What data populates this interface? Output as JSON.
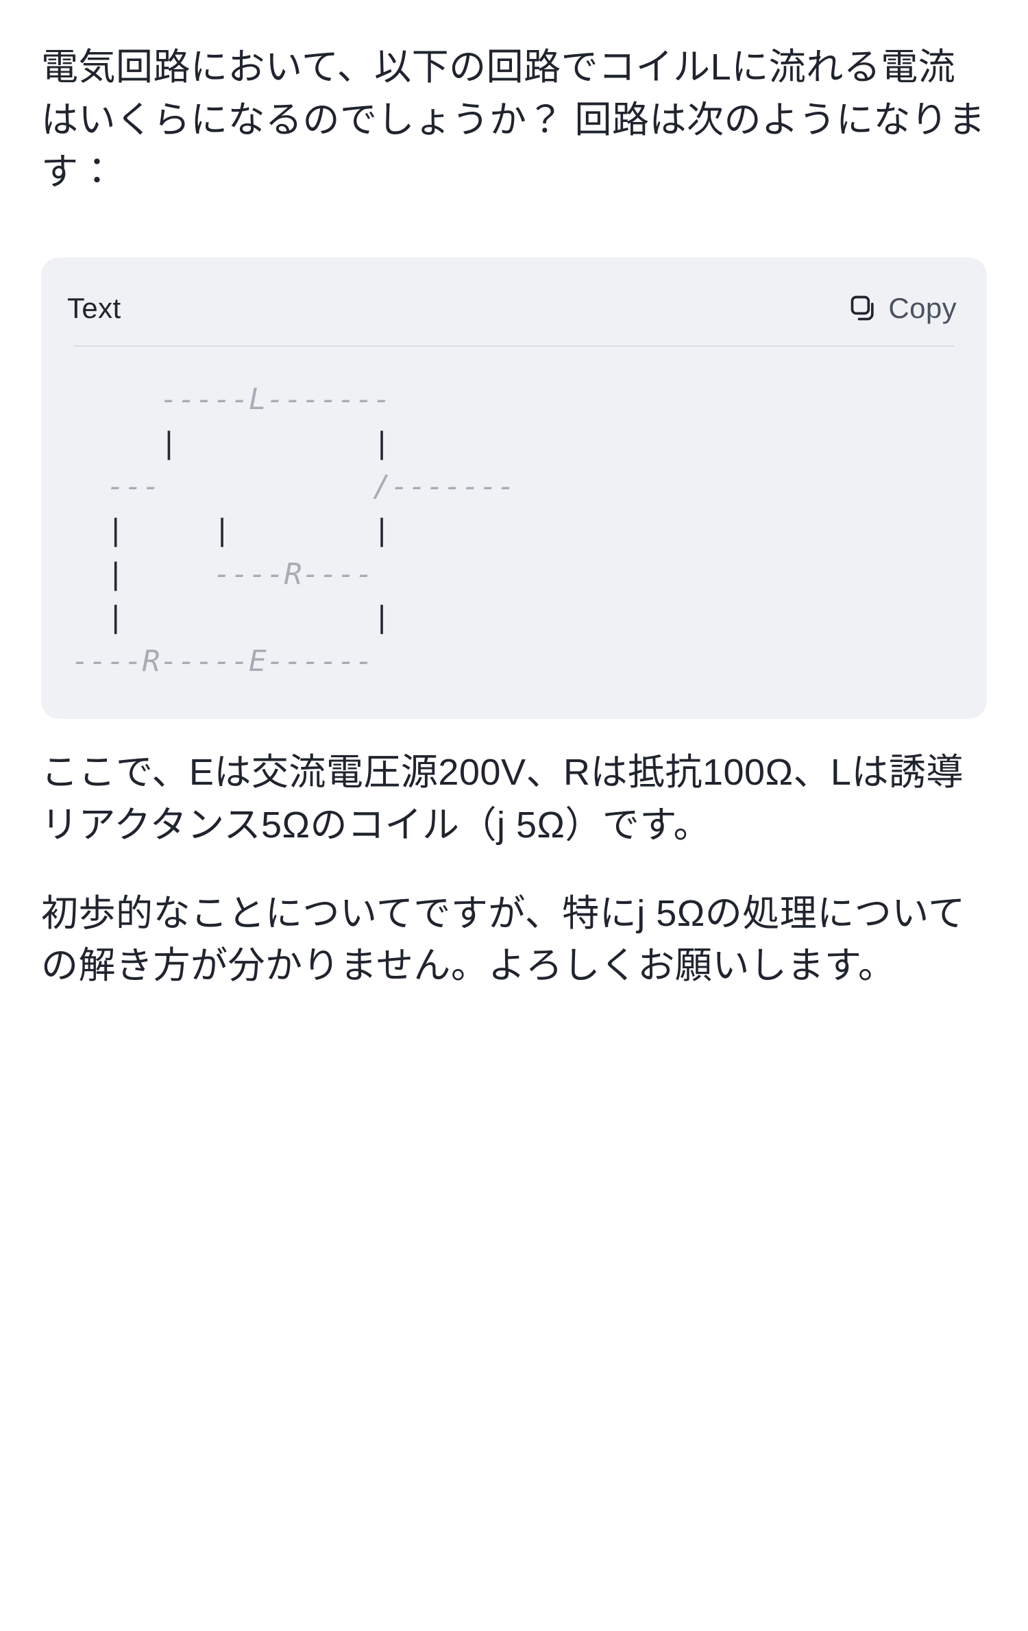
{
  "document": {
    "background_color": "#ffffff",
    "text_color": "#20242e"
  },
  "paragraphs": {
    "intro": "電気回路において、以下の回路でコイルLに流れる電流はいくらになるのでしょうか？ 回路は次のようになります：",
    "legend": "ここで、Eは交流電圧源200V、Rは抵抗100Ω、Lは誘導リアクタンス5Ωのコイル（j 5Ω）です。",
    "closing": "初歩的なことについてですが、特にj 5Ωの処理についての解き方が分かりません。よろしくお願いします。"
  },
  "code_card": {
    "background_color": "#eff1f5",
    "label": "Text",
    "copy_label": "Copy",
    "copy_icon": "copy-icon",
    "divider_color": "#d9dde4",
    "ascii_color_pipe": "#262a33",
    "ascii_color_dash": "#a7acb5",
    "ascii_lines": [
      "     -----L-------",
      "     |           |",
      "  ---            /-------",
      "  |     |        |",
      "  |     ----R----",
      "  |              |",
      "----R-----E------"
    ],
    "ascii_art": "     -----L-------\n     |           |\n  ---            /-------\n  |     |        |\n  |     ----R----\n  |              |\n----R-----E------",
    "circuit_symbols": {
      "L": "coil / inductor",
      "R": "resistor",
      "E": "AC voltage source"
    }
  },
  "values": {
    "source_voltage": "200V",
    "resistance": "100Ω",
    "inductive_reactance": "5Ω",
    "complex_reactance": "j 5Ω"
  }
}
